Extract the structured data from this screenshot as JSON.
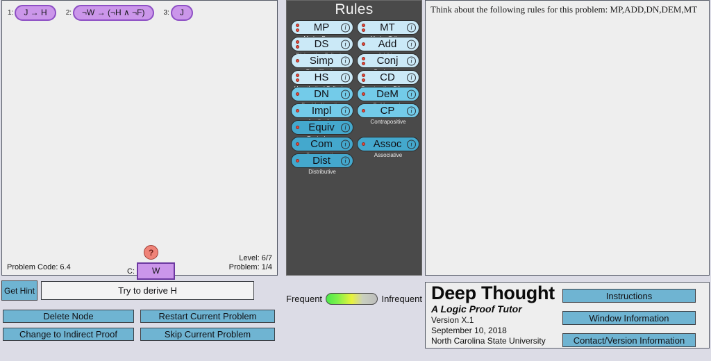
{
  "workspace": {
    "premises": [
      {
        "num": "1:",
        "text": "J → H"
      },
      {
        "num": "2:",
        "text": "¬W → (¬H ∧ ¬F)"
      },
      {
        "num": "3:",
        "text": "J"
      }
    ],
    "conclusion": {
      "marker": "?",
      "label": "C:",
      "text": "W"
    },
    "problem_code": "Problem Code: 6.4",
    "level": "Level: 6/7",
    "problem": "Problem: 1/4"
  },
  "hintbar": {
    "get_hint_label": "Get Hint",
    "goal_text": "Try to derive H"
  },
  "actions": {
    "delete_node": "Delete Node",
    "restart_problem": "Restart Current Problem",
    "indirect_proof": "Change to Indirect Proof",
    "skip_problem": "Skip Current Problem"
  },
  "rules": {
    "title": "Rules",
    "items": [
      {
        "abbr": "MP",
        "name": "Modus Ponens",
        "dots": 2,
        "shade": "pale",
        "col": 0,
        "row": 0
      },
      {
        "abbr": "MT",
        "name": "Modus Tollens",
        "dots": 2,
        "shade": "pale",
        "col": 1,
        "row": 0
      },
      {
        "abbr": "DS",
        "name": "Disjunctive Syllogism",
        "dots": 2,
        "shade": "pale",
        "col": 0,
        "row": 1
      },
      {
        "abbr": "Add",
        "name": "Addition",
        "dots": 1,
        "shade": "pale",
        "col": 1,
        "row": 1
      },
      {
        "abbr": "Simp",
        "name": "Simplification",
        "dots": 1,
        "shade": "pale",
        "col": 0,
        "row": 2
      },
      {
        "abbr": "Conj",
        "name": "Conjunction",
        "dots": 2,
        "shade": "pale",
        "col": 1,
        "row": 2
      },
      {
        "abbr": "HS",
        "name": "Hypothetical Syllogism",
        "dots": 2,
        "shade": "pale",
        "col": 0,
        "row": 3
      },
      {
        "abbr": "CD",
        "name": "Constructive Dilemma",
        "dots": 2,
        "shade": "pale",
        "col": 1,
        "row": 3
      },
      {
        "abbr": "DN",
        "name": "Double Negation",
        "dots": 1,
        "shade": "mid",
        "col": 0,
        "row": 4
      },
      {
        "abbr": "DeM",
        "name": "DeMorgan's",
        "dots": 1,
        "shade": "mid",
        "col": 1,
        "row": 4
      },
      {
        "abbr": "Impl",
        "name": "Implication",
        "dots": 1,
        "shade": "mid",
        "col": 0,
        "row": 5
      },
      {
        "abbr": "CP",
        "name": "Contrapositive",
        "dots": 1,
        "shade": "mid",
        "col": 1,
        "row": 5
      },
      {
        "abbr": "Equiv",
        "name": "Equivalence",
        "dots": 1,
        "shade": "deep",
        "col": 0,
        "row": 6
      },
      {
        "abbr": "Com",
        "name": "Commutative",
        "dots": 1,
        "shade": "deep",
        "col": 0,
        "row": 7
      },
      {
        "abbr": "Assoc",
        "name": "Associative",
        "dots": 1,
        "shade": "deep",
        "col": 1,
        "row": 7
      },
      {
        "abbr": "Dist",
        "name": "Distributive",
        "dots": 1,
        "shade": "deep",
        "col": 0,
        "row": 8
      }
    ],
    "info_glyph": "i"
  },
  "frequency": {
    "left_label": "Frequent",
    "right_label": "Infrequent"
  },
  "message": {
    "text": "Think about the following rules for this problem: MP,ADD,DN,DEM,MT"
  },
  "about": {
    "app_title": "Deep Thought",
    "app_subtitle": "A Logic Proof Tutor",
    "version": "Version X.1",
    "date": "September 10, 2018",
    "institution": "North Carolina State University",
    "buttons": {
      "instructions": "Instructions",
      "window_information": "Window Information",
      "contact_version": "Contact/Version Information"
    }
  },
  "colors": {
    "node_fill": "#cb96ea",
    "node_border": "#8d4fc4",
    "button_blue": "#6fb4d2",
    "rule_pale": "#cbe9f7",
    "rule_mid": "#73cbe9",
    "rule_deep": "#44a8cd",
    "dot_red": "#e8483a",
    "panel_bg": "#eeeeee",
    "page_bg": "#dcdce6",
    "rules_bg": "#4a4a4a"
  }
}
